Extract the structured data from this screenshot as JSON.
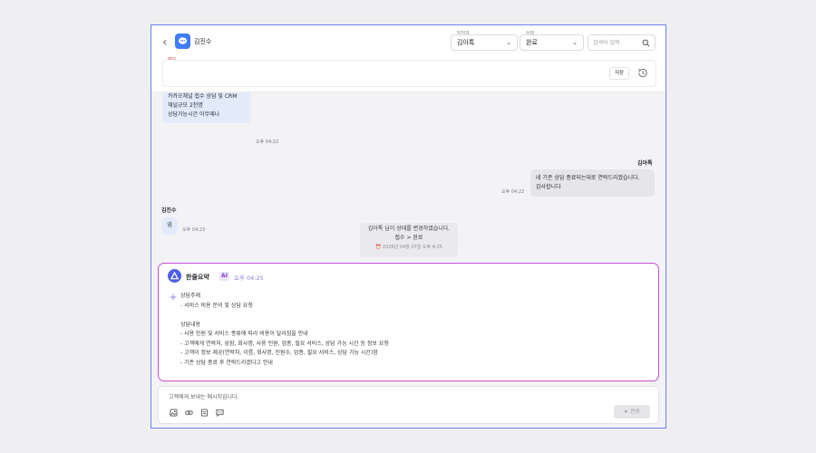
{
  "header": {
    "customer_name": "김진수",
    "assignee_label": "담당자",
    "assignee_value": "김아톡",
    "status_label": "상태",
    "status_value": "완료",
    "search_placeholder": "검색어 입력"
  },
  "memo": {
    "label": "메모",
    "save_label": "저장"
  },
  "messages": {
    "m1_lines": [
      "카카오채널 접수 상담 및 CRM",
      "채널규모 2천명",
      "상담가능시간 아무때나"
    ],
    "m1_time": "오후 04:22",
    "m2_sender": "김아톡",
    "m2_lines": [
      "네 기존 상담 종료되는대로 연락드리겠습니다.",
      "감사합니다"
    ],
    "m2_time": "오후 04:22",
    "m3_sender": "김진수",
    "m3_text": "넵",
    "m3_time": "오후 04:23"
  },
  "system_notice": {
    "line1": "김아톡 님이 상태를 변경하였습니다.",
    "line2": "접수 > 완료",
    "timestamp": "2026년 04월 07일 오후 4:25"
  },
  "summary": {
    "title": "한줄요약",
    "ai_badge": "AI",
    "time": "오후 04:25",
    "body": "상담주제\n- 서비스 비용 문의 및 상담 요청\n\n상담내용\n- 사용 인원 및 서비스 종류에 따라 비용이 달라짐을 안내\n- 고객에게 연락처, 성함, 회사명, 사용 인원, 업종, 필요 서비스, 상담 가능 시간 등 정보 요청\n- 고객이 정보 제공(연락처, 이름, 회사명, 인원수, 업종, 필요 서비스, 상담 가능 시간)함\n- 기존 상담 종료 후 연락드리겠다고 안내"
  },
  "composer": {
    "placeholder": "고객에게 보내는 메시지입니다.",
    "send_label": "전송"
  },
  "colors": {
    "frame_border": "#6b84e6",
    "summary_border": "#c94fd6",
    "avatar": "#3f7cf5",
    "summary_logo": "#4d5ee8"
  },
  "icons": [
    "back-chevron-icon",
    "chat-avatar-icon",
    "chevron-down-icon",
    "search-icon",
    "history-icon",
    "summary-logo-icon",
    "sparkle-icon",
    "image-attach-icon",
    "link-icon",
    "document-icon",
    "template-icon",
    "send-icon"
  ]
}
